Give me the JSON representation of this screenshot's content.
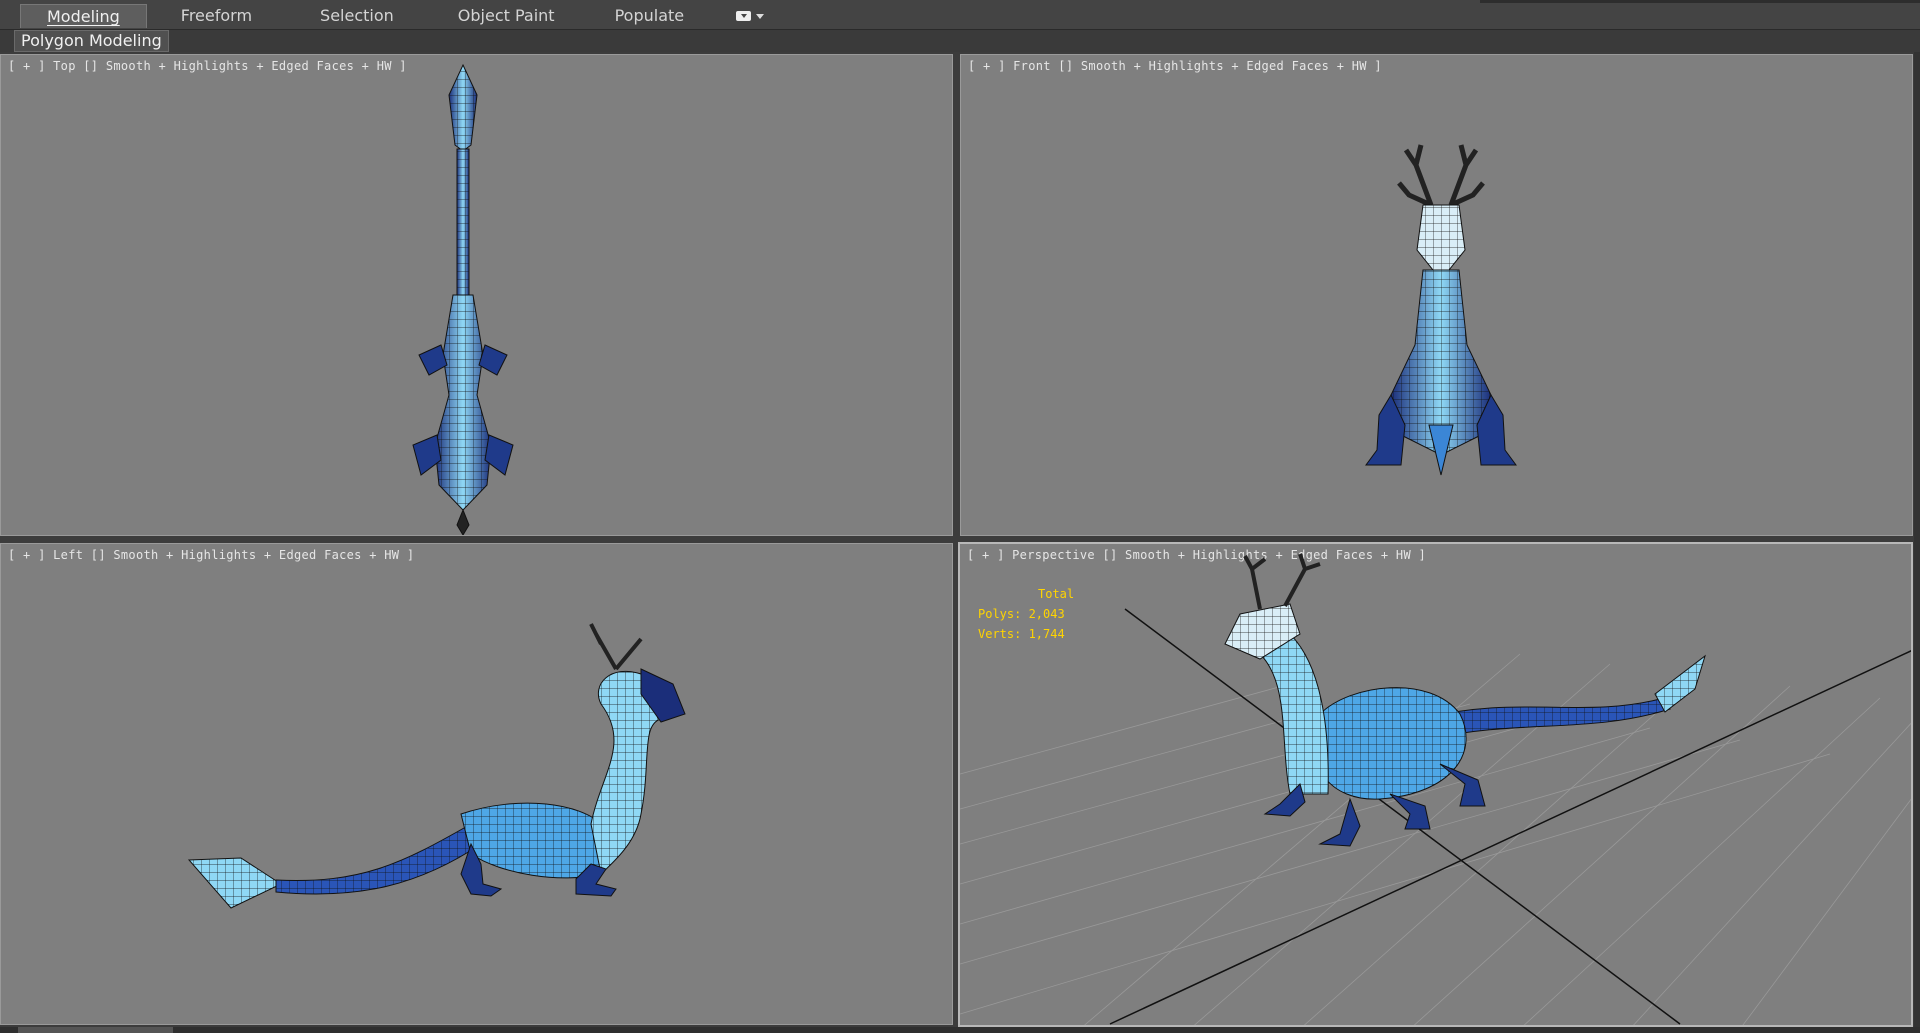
{
  "ribbon": {
    "tabs": [
      {
        "label": "Modeling",
        "active": true
      },
      {
        "label": "Freeform",
        "active": false
      },
      {
        "label": "Selection",
        "active": false
      },
      {
        "label": "Object Paint",
        "active": false
      },
      {
        "label": "Populate",
        "active": false
      }
    ],
    "menu_icon": "ribbon-options-icon",
    "panel_label": "Polygon Modeling"
  },
  "viewports": {
    "top": {
      "label_prefix": "[ + ] ",
      "view": "Top",
      "mode": "Smooth + Highlights + Edged Faces + HW ]"
    },
    "front": {
      "label_prefix": "[ + ] ",
      "view": "Front",
      "mode": "Smooth + Highlights + Edged Faces + HW ]"
    },
    "left": {
      "label_prefix": "[ + ] ",
      "view": "Left",
      "mode": "Smooth + Highlights + Edged Faces + HW ]"
    },
    "perspective": {
      "label_prefix": "[ + ] ",
      "view": "Perspective",
      "mode": "Smooth + Highlights + Edged Faces + HW ]",
      "stats": {
        "total": "Total",
        "polys": "Polys: 2,043",
        "verts": "Verts: 1,744"
      }
    }
  },
  "colors": {
    "viewport_bg": "#7f7f7f",
    "model_light": "#8fd8f5",
    "model_mid": "#3b86d6",
    "model_dark": "#1b2e7a",
    "stats_text": "#ffd400"
  }
}
